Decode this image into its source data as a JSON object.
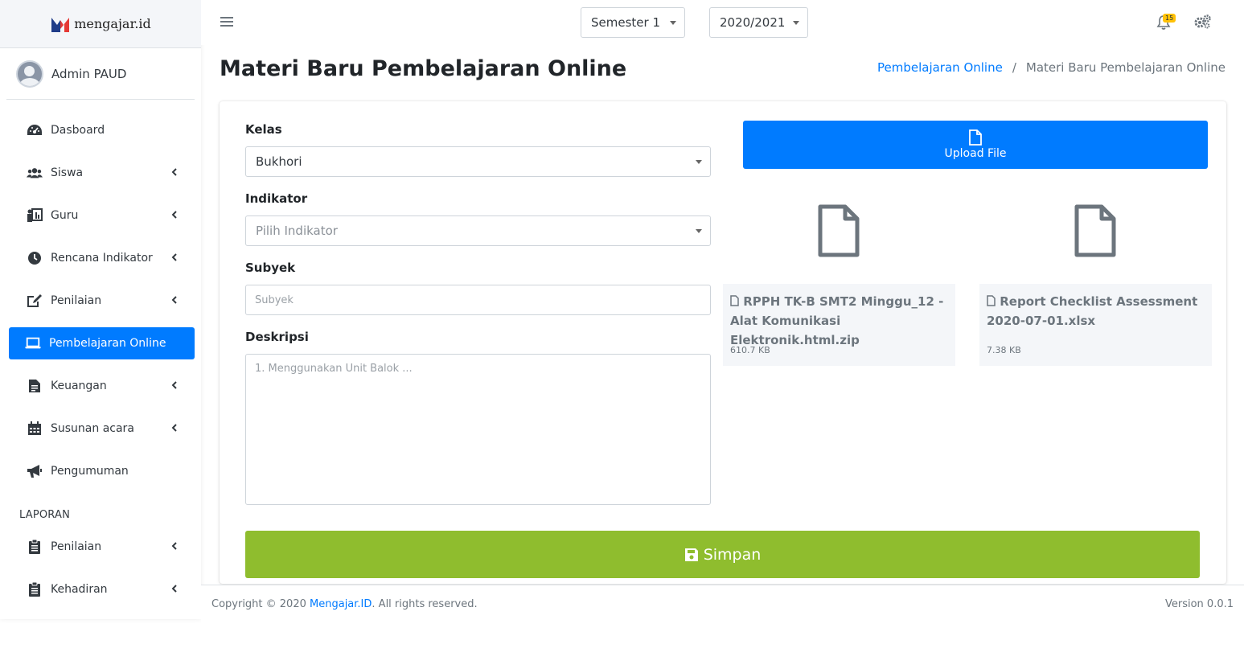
{
  "brand": {
    "name": "mengajar.id"
  },
  "user": {
    "name": "Admin PAUD"
  },
  "sidebar": {
    "items": [
      {
        "label": "Dasboard",
        "icon": "tachometer-icon"
      },
      {
        "label": "Siswa",
        "icon": "users-icon"
      },
      {
        "label": "Guru",
        "icon": "chalkboard-teacher-icon"
      },
      {
        "label": "Rencana Indikator",
        "icon": "clock-icon"
      },
      {
        "label": "Penilaian",
        "icon": "edit-icon"
      },
      {
        "label": "Pembelajaran Online",
        "icon": "laptop-icon"
      },
      {
        "label": "Keuangan",
        "icon": "file-invoice-icon"
      },
      {
        "label": "Susunan acara",
        "icon": "calendar-icon"
      },
      {
        "label": "Pengumuman",
        "icon": "bullhorn-icon"
      }
    ],
    "section_header": "LAPORAN",
    "report_items": [
      {
        "label": "Penilaian",
        "icon": "clipboard-icon"
      },
      {
        "label": "Kehadiran",
        "icon": "clipboard-icon"
      }
    ]
  },
  "topbar": {
    "semester": "Semester 1",
    "year": "2020/2021",
    "notification_count": "15",
    "accent": "#007bff"
  },
  "page": {
    "title": "Materi Baru Pembelajaran Online",
    "breadcrumb": {
      "parent": "Pembelajaran Online",
      "separator": "/",
      "current": "Materi Baru Pembelajaran Online"
    }
  },
  "form": {
    "kelas_label": "Kelas",
    "kelas_value": "Bukhori",
    "indikator_label": "Indikator",
    "indikator_placeholder": "Pilih Indikator",
    "subyek_label": "Subyek",
    "subyek_placeholder": "Subyek",
    "deskripsi_label": "Deskripsi",
    "deskripsi_placeholder": "1. Menggunakan Unit Balok ...",
    "save_label": "Simpan",
    "save_color": "#8fbd2e"
  },
  "upload": {
    "label": "Upload File",
    "files": [
      {
        "name": "RPPH TK-B SMT2 Minggu_12 - Alat Komunikasi Elektronik.html.zip",
        "size": "610.7 KB"
      },
      {
        "name": "Report Checklist Assessment 2020-07-01.xlsx",
        "size": "7.38 KB"
      }
    ]
  },
  "footer": {
    "copyright_prefix": "Copyright © 2020 ",
    "brand_link": "Mengajar.ID",
    "copyright_suffix": ". All rights reserved.",
    "version": "Version 0.0.1"
  }
}
